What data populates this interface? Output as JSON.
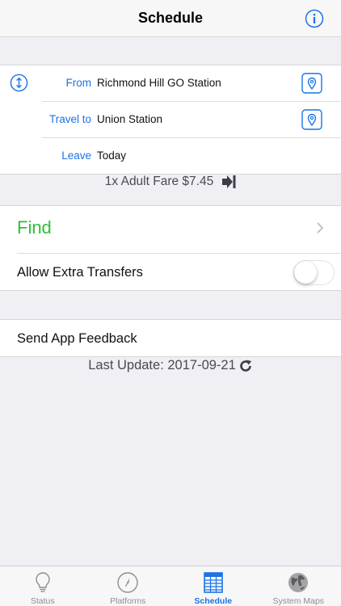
{
  "navbar": {
    "title": "Schedule",
    "info_icon": "info-icon"
  },
  "trip": {
    "from_label": "From",
    "from_value": "Richmond Hill GO Station",
    "to_label": "Travel to",
    "to_value": "Union Station",
    "leave_label": "Leave",
    "leave_value": "Today"
  },
  "fare": {
    "text": "1x Adult Fare $7.45",
    "icon": "arrow-to-line-icon"
  },
  "actions": {
    "find_label": "Find",
    "find_color": "#2fbf3a",
    "extra_transfers_label": "Allow Extra Transfers",
    "extra_transfers_enabled": false
  },
  "feedback": {
    "label": "Send App Feedback"
  },
  "last_update": {
    "text": "Last Update: 2017-09-21",
    "icon": "refresh-icon"
  },
  "tabbar": {
    "tabs": [
      {
        "label": "Status",
        "icon": "lightbulb-icon",
        "active": false
      },
      {
        "label": "Platforms",
        "icon": "compass-icon",
        "active": false
      },
      {
        "label": "Schedule",
        "icon": "schedule-icon",
        "active": true
      },
      {
        "label": "System Maps",
        "icon": "globe-icon",
        "active": false
      }
    ]
  },
  "colors": {
    "accent": "#1a73e8",
    "find_green": "#2fbf3a",
    "background": "#efeff4"
  }
}
